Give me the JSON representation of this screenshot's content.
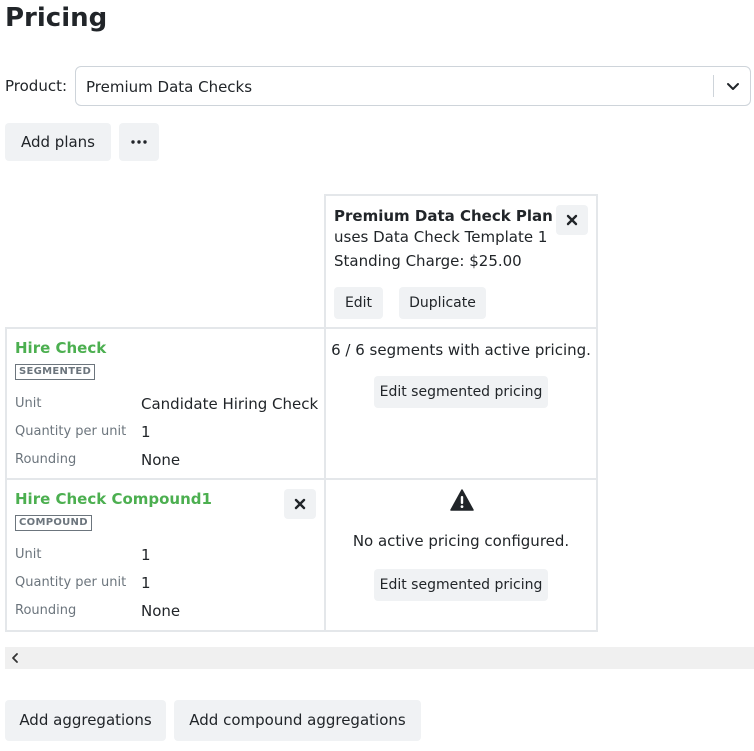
{
  "page": {
    "title": "Pricing"
  },
  "product": {
    "label": "Product:",
    "selected": "Premium Data Checks"
  },
  "actions": {
    "add_plans": "Add plans",
    "more_label": "More options"
  },
  "plan": {
    "name": "Premium Data Check Plan",
    "uses": "uses Data Check Template 1",
    "standing_charge": "Standing Charge: $25.00",
    "edit_label": "Edit",
    "duplicate_label": "Duplicate"
  },
  "aggregations": [
    {
      "title": "Hire Check",
      "badge": "SEGMENTED",
      "unit_label": "Unit",
      "unit_value": "Candidate Hiring Check",
      "qty_label": "Quantity per unit",
      "qty_value": "1",
      "rounding_label": "Rounding",
      "rounding_value": "None",
      "pricing_status": "6 / 6 segments with active pricing.",
      "edit_pricing": "Edit segmented pricing"
    },
    {
      "title": "Hire Check Compound1",
      "badge": "COMPOUND",
      "unit_label": "Unit",
      "unit_value": "1",
      "qty_label": "Quantity per unit",
      "qty_value": "1",
      "rounding_label": "Rounding",
      "rounding_value": "None",
      "pricing_status": "No active pricing configured.",
      "edit_pricing": "Edit segmented pricing"
    }
  ],
  "footer": {
    "add_aggregations": "Add aggregations",
    "add_compound_aggregations": "Add compound aggregations"
  },
  "colors": {
    "accent_green": "#4caf50",
    "button_bg": "#f0f2f4",
    "border": "#e4e7ea",
    "text": "#212529",
    "muted": "#6c757d"
  },
  "icons": {
    "more": "ellipsis-icon",
    "close": "close-icon",
    "dropdown": "chevron-down-icon",
    "warning": "warning-triangle-icon",
    "scroll_left": "chevron-left-icon"
  }
}
